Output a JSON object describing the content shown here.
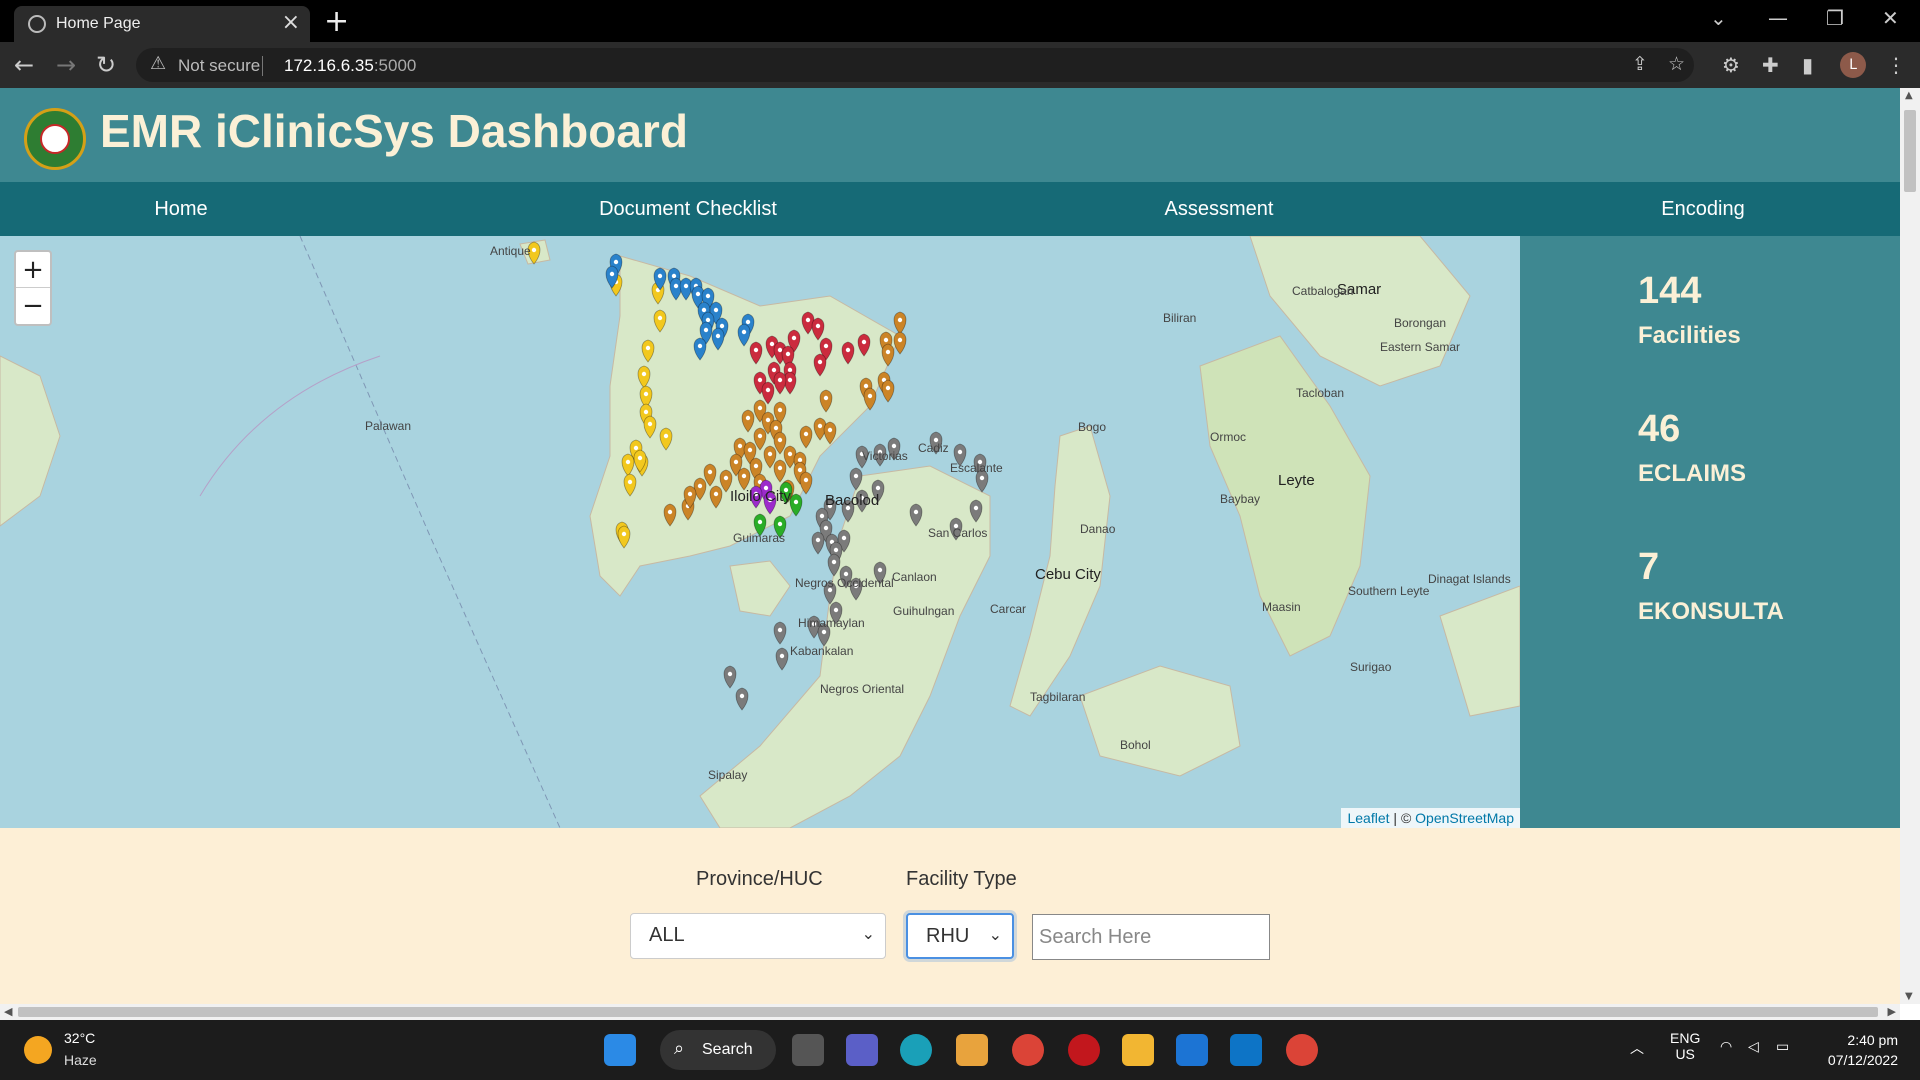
{
  "browser": {
    "tab_title": "Home Page",
    "url_warning": "Not secure",
    "url_host": "172.16.6.35",
    "url_port": ":5000"
  },
  "header": {
    "title": "EMR iClinicSys Dashboard"
  },
  "nav": {
    "items": [
      {
        "label": "Home"
      },
      {
        "label": "Document Checklist"
      },
      {
        "label": "Assessment"
      },
      {
        "label": "Encoding"
      }
    ]
  },
  "map": {
    "zoom_in": "+",
    "zoom_out": "−",
    "attribution_leaflet": "Leaflet",
    "attribution_sep": " | © ",
    "attribution_osm": "OpenStreetMap",
    "labels": [
      "Antique",
      "Palawan",
      "Iloilo City",
      "Bacolod",
      "Guimaras",
      "Negros Occidental",
      "Cebu City",
      "Bohol",
      "Leyte",
      "Samar",
      "Tacloban",
      "Bogo",
      "Danao",
      "Carcar",
      "Sipalay",
      "Kabankalan",
      "Himamaylan",
      "San Carlos",
      "Canlaon",
      "Guihulngan",
      "Ormoc",
      "Baybay",
      "Maasin",
      "Southern Leyte",
      "Eastern Samar",
      "Borongan",
      "Catbalogan",
      "Biliran",
      "Cadiz",
      "Escalante",
      "Victorias",
      "Negros Oriental",
      "Tagbilaran",
      "Surigao",
      "Dinagat Islands"
    ],
    "marker_colors": {
      "yellow": "#f2c81e",
      "blue": "#2a82cb",
      "red": "#cb2b3e",
      "orange": "#cb8427",
      "gray": "#7b7b7b",
      "green": "#2aad27",
      "violet": "#9c2bcb"
    }
  },
  "stats": [
    {
      "value": "144",
      "label": "Facilities"
    },
    {
      "value": "46",
      "label": "ECLAIMS"
    },
    {
      "value": "7",
      "label": "EKONSULTA"
    }
  ],
  "filters": {
    "province_label": "Province/HUC",
    "province_value": "ALL",
    "facility_type_label": "Facility Type",
    "facility_type_value": "RHU",
    "search_placeholder": "Search Here"
  },
  "taskbar": {
    "temperature": "32°C",
    "weather": "Haze",
    "search_label": "Search",
    "lang": "ENG",
    "region": "US",
    "time": "2:40 pm",
    "date": "07/12/2022"
  }
}
